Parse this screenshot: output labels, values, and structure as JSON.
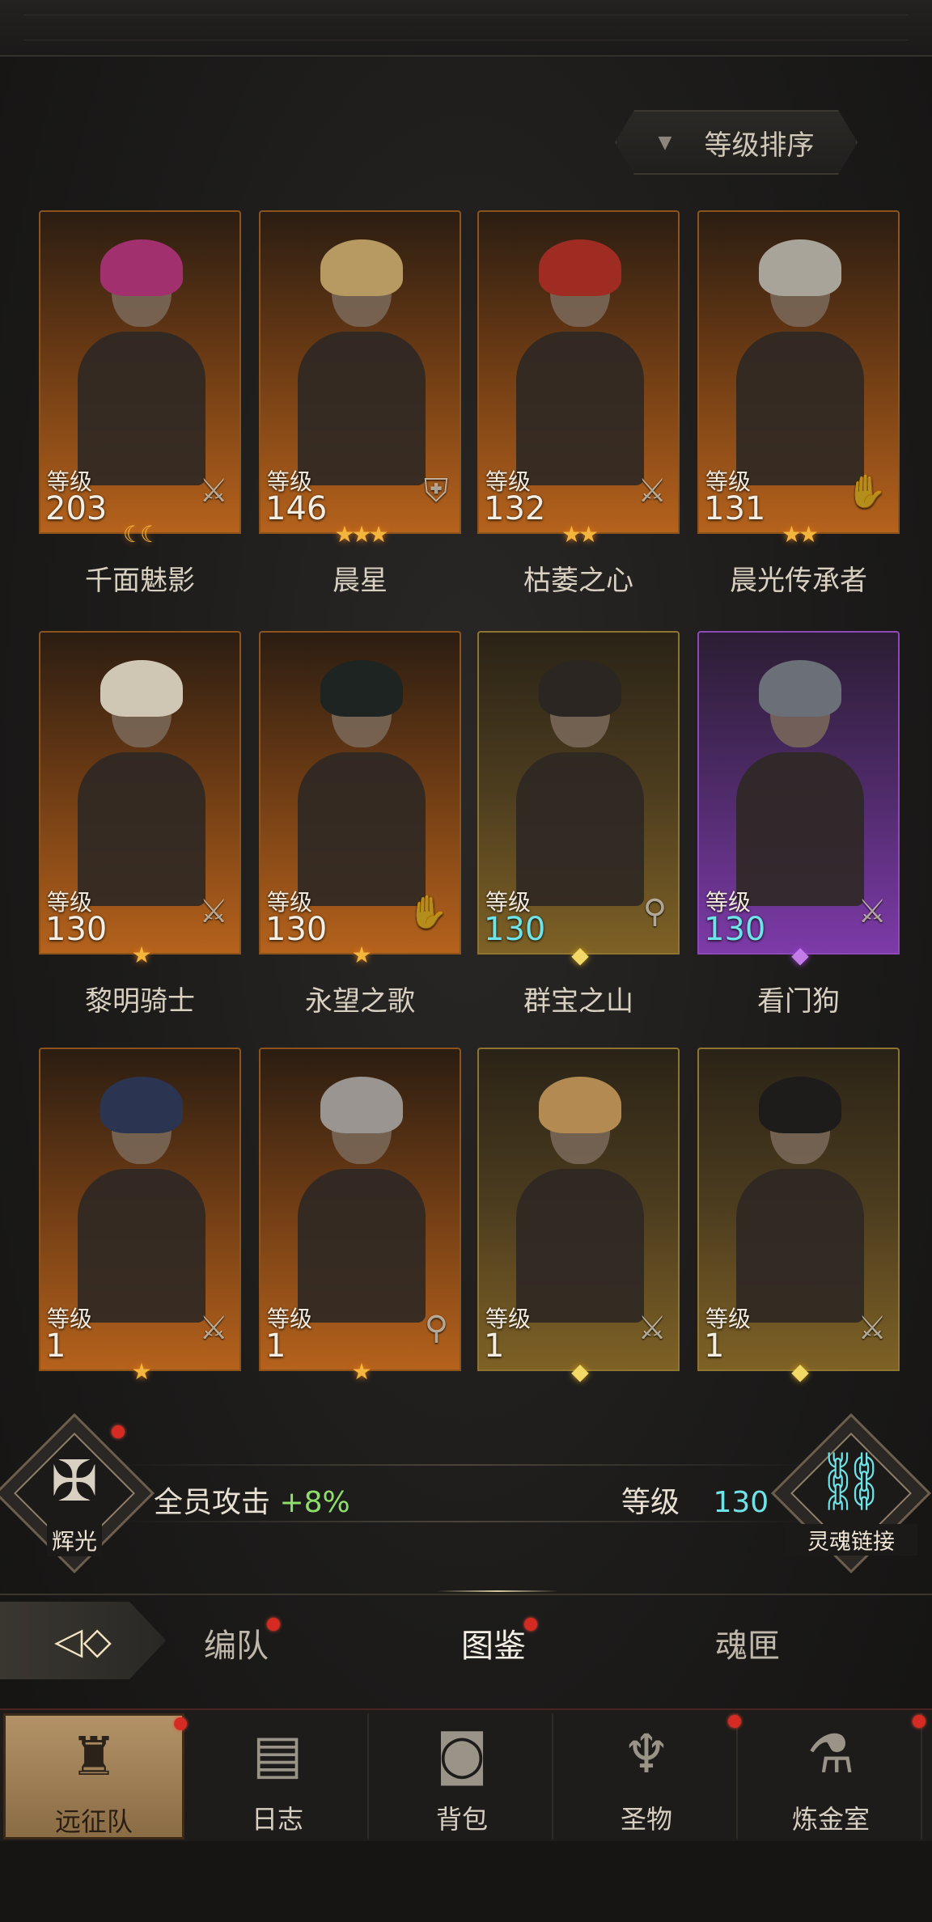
{
  "sort": {
    "label": "等级排序",
    "icon": "dropdown-triangle-icon"
  },
  "heroes": [
    {
      "name": "千面魅影",
      "level_label": "等级",
      "level": "203",
      "class_icon": "sword-icon",
      "rarity": "orange",
      "stars": "☾☾",
      "star_style": ""
    },
    {
      "name": "晨星",
      "level_label": "等级",
      "level": "146",
      "class_icon": "shield-icon",
      "rarity": "orange",
      "stars": "★★★",
      "star_style": ""
    },
    {
      "name": "枯萎之心",
      "level_label": "等级",
      "level": "132",
      "class_icon": "sword-icon",
      "rarity": "orange",
      "stars": "★★",
      "star_style": ""
    },
    {
      "name": "晨光传承者",
      "level_label": "等级",
      "level": "131",
      "class_icon": "hand-icon",
      "rarity": "orange",
      "stars": "★★",
      "star_style": ""
    },
    {
      "name": "黎明骑士",
      "level_label": "等级",
      "level": "130",
      "class_icon": "sword-icon",
      "rarity": "orange",
      "stars": "★",
      "star_style": ""
    },
    {
      "name": "永望之歌",
      "level_label": "等级",
      "level": "130",
      "class_icon": "hand-icon",
      "rarity": "orange",
      "stars": "★",
      "star_style": ""
    },
    {
      "name": "群宝之山",
      "level_label": "等级",
      "level": "130",
      "class_icon": "staff-icon",
      "rarity": "gold",
      "stars": "◆",
      "star_style": "dia",
      "cyan": true
    },
    {
      "name": "看门狗",
      "level_label": "等级",
      "level": "130",
      "class_icon": "sword-icon",
      "rarity": "purple",
      "stars": "◆",
      "star_style": "pdia",
      "cyan": true
    },
    {
      "name": "",
      "level_label": "等级",
      "level": "1",
      "class_icon": "sword-icon",
      "rarity": "orange",
      "stars": "★",
      "star_style": ""
    },
    {
      "name": "",
      "level_label": "等级",
      "level": "1",
      "class_icon": "staff-icon",
      "rarity": "orange",
      "stars": "★",
      "star_style": ""
    },
    {
      "name": "",
      "level_label": "等级",
      "level": "1",
      "class_icon": "sword-icon",
      "rarity": "gold",
      "stars": "◆",
      "star_style": "dia"
    },
    {
      "name": "",
      "level_label": "等级",
      "level": "1",
      "class_icon": "sword-icon",
      "rarity": "gold",
      "stars": "◆",
      "star_style": "dia"
    }
  ],
  "status": {
    "radiance_label": "辉光",
    "bonus_label": "全员攻击",
    "bonus_value": "+8%",
    "soul_level_label": "等级",
    "soul_level_value": "130",
    "soul_link_label": "灵魂链接"
  },
  "tabs": [
    {
      "label": "编队",
      "has_dot": true
    },
    {
      "label": "图鉴",
      "has_dot": true,
      "active": true
    },
    {
      "label": "魂匣",
      "has_dot": false
    }
  ],
  "nav": [
    {
      "label": "远征队",
      "icon": "helmet-icon",
      "active": true
    },
    {
      "label": "日志",
      "icon": "scroll-icon"
    },
    {
      "label": "背包",
      "icon": "backpack-icon"
    },
    {
      "label": "圣物",
      "icon": "chalice-icon"
    },
    {
      "label": "炼金室",
      "icon": "alchemy-icon"
    }
  ],
  "colors": {
    "accent_cyan": "#6fe3e8",
    "bonus_green": "#8ddf6a",
    "notify_red": "#d62b22"
  }
}
